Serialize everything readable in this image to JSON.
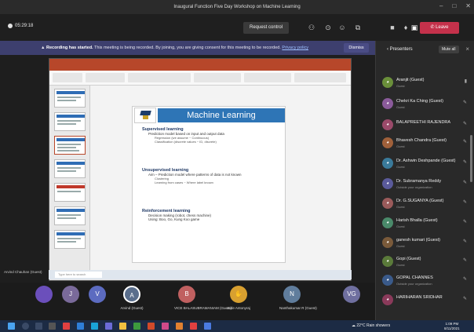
{
  "window": {
    "title": "Inaugural Function Five Day Workshop on Machine Learning",
    "controls": [
      "–",
      "□",
      "✕"
    ]
  },
  "meeting_bar": {
    "timer": "05:29:18",
    "request_control": "Request control",
    "leave": "Leave"
  },
  "banner": {
    "label": "Recording has started.",
    "text": "This meeting is being recorded. By joining, you are giving consent for this meeting to be recorded.",
    "privacy_link": "Privacy policy",
    "dismiss": "Dismiss"
  },
  "shared_screen": {
    "slide": {
      "title": "Machine Learning",
      "sections": [
        {
          "heading": "Supervised learning",
          "items": [
            {
              "text": "Prediction model based on input and output data",
              "sub": [
                "Regression (we assume ~ Continuous)",
                "Classification (discrete values ~ ID, discrete)"
              ]
            }
          ]
        },
        {
          "heading": "Unsupervised learning",
          "items": [
            {
              "text": "Aim – Prediction model where patterns of data is not known",
              "sub": [
                "Clustering",
                "Learning from cases ~ Where label known"
              ]
            }
          ]
        },
        {
          "heading": "Reinforcement learning",
          "items": [
            {
              "text": "Decision making (robot, chess machine)",
              "sub": []
            },
            {
              "text": "Using: Boo, Go, Kung Koo game",
              "sub": []
            }
          ]
        }
      ]
    },
    "taskbar_search": "Type here to search",
    "caller_label": "Arvind Chauhan (Guest)"
  },
  "participant_tiles": [
    {
      "initial": "",
      "name": "",
      "color": "#6b4fbb"
    },
    {
      "initial": "J",
      "name": "",
      "color": "#7a6a9a"
    },
    {
      "initial": "V",
      "name": "",
      "color": "#5c6bc0"
    },
    {
      "initial": "A",
      "name": "Arvind (Guest)",
      "color": "#5a6e8c"
    },
    {
      "initial": "B",
      "name": "VICE BALASUBRAMANIAM (Guest)",
      "color": "#c06060"
    },
    {
      "initial": "",
      "name": "Jude Antonyraj",
      "color": "#d8a030"
    },
    {
      "initial": "N",
      "name": "Nanthakumar R (Guest)",
      "color": "#607d9c"
    },
    {
      "initial": "VG",
      "name": "",
      "color": "#6f6f9f"
    }
  ],
  "panel": {
    "title": "Presenters",
    "mute_all": "Mute all",
    "participants": [
      {
        "name": "Aranjit (Guest)",
        "status": "Guest",
        "color": "#6a8f3a"
      },
      {
        "name": "Chekri Ka Ching (Guest)",
        "status": "Guest",
        "color": "#8a5a9a"
      },
      {
        "name": "BALAPREETHI RAJENDRA",
        "status": "",
        "color": "#9a4a6a"
      },
      {
        "name": "Bhavesh Chandra (Guest)",
        "status": "Guest",
        "color": "#a0603a"
      },
      {
        "name": "Dr. Ashwin Deshpande (Guest)",
        "status": "Guest",
        "color": "#3a7a9a"
      },
      {
        "name": "Dr. Subramanya Reddy",
        "status": "Outside your organization",
        "color": "#5a5a9a"
      },
      {
        "name": "Dr. G.SUGANYA (Guest)",
        "status": "Guest",
        "color": "#9a5a5a"
      },
      {
        "name": "Harish Bhalla (Guest)",
        "status": "Guest",
        "color": "#4a8a6a"
      },
      {
        "name": "ganesh kumari (Guest)",
        "status": "Guest",
        "color": "#7a5a3a"
      },
      {
        "name": "Gopi (Guest)",
        "status": "Guest",
        "color": "#5a7a3a"
      },
      {
        "name": "GOPAL CHANNES",
        "status": "Outside your organization",
        "color": "#3a5a8a"
      },
      {
        "name": "HARIHARAN SRIDHAR",
        "status": "",
        "color": "#8a3a5a"
      }
    ]
  },
  "win_taskbar": {
    "weather": "22°C Rain showers",
    "time": "1:09 PM",
    "date": "8/11/2021"
  }
}
